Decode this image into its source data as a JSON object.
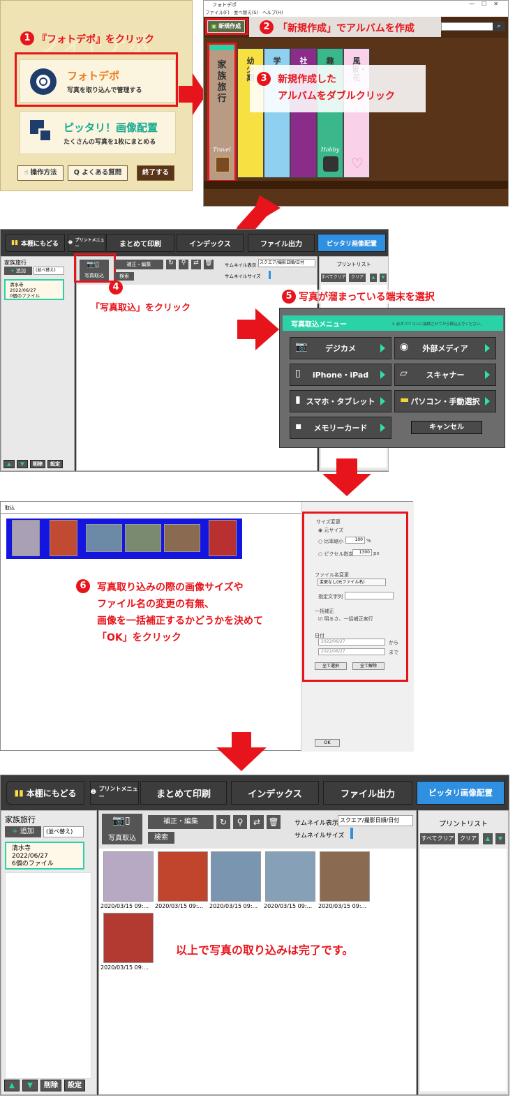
{
  "step1": {
    "num": "1",
    "instruction": "『フォトデポ』をクリック",
    "photodepo": {
      "title": "フォトデポ",
      "desc": "写真を取り込んで管理する"
    },
    "pittari": {
      "title": "ピッタリ！画像配置",
      "desc": "たくさんの写真を1枚にまとめる"
    },
    "buttons": {
      "howto": "操作方法",
      "faq": "よくある質問",
      "exit": "終了する"
    },
    "bg_text": "フォトデポ"
  },
  "step2": {
    "window_title": "フォトデポ",
    "menu": [
      "ファイル(F)",
      "並べ替え(S)",
      "ヘルプ(H)"
    ],
    "new_button": "新規作成",
    "num": "2",
    "instruction": "「新規作成」でアルバムを作成",
    "books": [
      {
        "title": "家族旅行",
        "label": "Travel"
      },
      {
        "title": "幼少期"
      },
      {
        "title": "学"
      },
      {
        "title": "社"
      },
      {
        "title": "趣",
        "label": "Hobby"
      },
      {
        "title": "風景・花"
      }
    ]
  },
  "step3": {
    "num": "3",
    "line1": "新規作成した",
    "line2": "アルバムをダブルクリック"
  },
  "toolbar_small": {
    "shelf": "本棚にもどる",
    "print_menu": "プリントメニュー",
    "batch_print": "まとめて印刷",
    "index": "インデックス",
    "file_out": "ファイル出力",
    "pittari": "ピッタリ画像配置"
  },
  "album_small": {
    "name": "家族旅行",
    "add": "追加",
    "sort": "(並べ替え)",
    "item_lines": [
      "清水寺",
      "2022/06/27",
      "0個のファイル"
    ],
    "import": "写真取込",
    "edit": "補正・編集",
    "search": "検索",
    "thumb_label": "サムネイル表示",
    "thumb_select": "スクエア/撮影日順/日付",
    "thumb_size": "サムネイルサイズ",
    "print_list": "プリントリスト",
    "clear_all": "すべてクリア",
    "clear": "クリア",
    "delete": "削除",
    "settings": "設定"
  },
  "step4": {
    "num": "4",
    "instruction": "「写真取込」をクリック"
  },
  "step5": {
    "num": "5",
    "instruction": "写真が溜まっている端末を選択",
    "menu_title": "写真取込メニュー",
    "menu_note": "必ずパソコンに接続させてから取込んでください。",
    "buttons": [
      "デジカメ",
      "外部メディア",
      "iPhone・iPad",
      "スキャナー",
      "スマホ・タブレット",
      "パソコン・手動選択",
      "メモリーカード"
    ],
    "cancel": "キャンセル"
  },
  "step6": {
    "window_title": "取込",
    "num": "6",
    "lines": [
      "写真取り込みの際の画像サイズや",
      "ファイル名の変更の有無、",
      "画像を一括補正するかどうかを決めて",
      "「OK」をクリック"
    ],
    "size_header": "サイズ変更",
    "size_options": [
      "元サイズ",
      "比率縮小",
      "ピクセル指定"
    ],
    "ratio_value": "100",
    "ratio_unit": "%",
    "px_value": "1300",
    "px_unit": "px",
    "rename_header": "ファイル名変更",
    "rename_select": "変更なし(元ファイル名)",
    "rename_label": "指定文字列",
    "correct_header": "一括補正",
    "correct_option": "明るさ、一括補正実行",
    "date_header": "日付",
    "date_from": "2022/06/27",
    "date_to": "2022/06/27",
    "from_label": "から",
    "to_label": "まで",
    "select_all": "全て選択",
    "deselect_all": "全て解除",
    "ok": "OK"
  },
  "final": {
    "item_lines": [
      "清水寺",
      "2022/06/27",
      "6個のファイル"
    ],
    "thumb_caption": "2020/03/15 09:...",
    "message": "以上で写真の取り込みは完了です。"
  },
  "colors": {
    "accent_red": "#e8141b",
    "teal": "#2ad3a7",
    "pittari_blue": "#2f8fe0"
  }
}
